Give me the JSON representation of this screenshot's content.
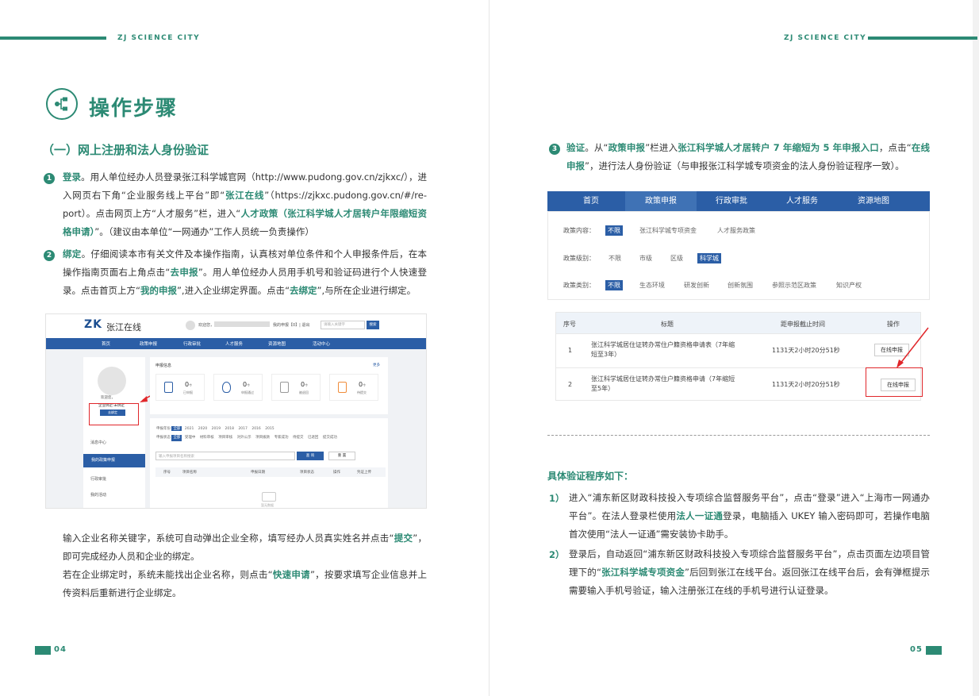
{
  "header": {
    "brand": "ZJ SCIENCE CITY"
  },
  "left": {
    "title": "操作步骤",
    "section_heading": "（一）网上注册和法人身份验证",
    "step1": {
      "num": "1",
      "label": "登录",
      "t1": "。用人单位经办人员登录张江科学城官网（http://www.pudong.gov.cn/zjkxc/），进入网页右下角“企业服务线上平台”即“",
      "h1": "张江在线",
      "t2": "”（https://zjkxc.pudong.gov.cn/#/re-port）。点击网页上方“人才服务”栏，进入“",
      "h2": "人才政策（张江科学城人才居转户年限缩短资格申请）",
      "t3": "”。（建议由本单位“一网通办”工作人员统一负责操作）"
    },
    "step2": {
      "num": "2",
      "label": "绑定",
      "t1": "。仔细阅读本市有关文件及本操作指南，认真核对单位条件和个人申报条件后，在本操作指南页面右上角点击“",
      "h1": "去申报",
      "t2": "”。用人单位经办人员用手机号和验证码进行个人快速登录。点击首页上方“",
      "h2": "我的申报",
      "t3": "”,进入企业绑定界面。点击“",
      "h3": "去绑定",
      "t4": "”,与所在企业进行绑定。"
    },
    "shot": {
      "logo": "ZK",
      "site": "张江在线",
      "welcome": "欢迎您，",
      "menu": "我的申报【0】| 退出",
      "search_ph": "请输入关键字",
      "search_btn": "搜索",
      "nav": [
        "首页",
        "政策申报",
        "行政审批",
        "人才服务",
        "资源地图",
        "活动中心"
      ],
      "user_hello": "欢迎您，",
      "user_status": "企业绑定:未绑定",
      "bind_btn": "去绑定",
      "side_menu": [
        "消息中心",
        "我的政策申报",
        "行政审批",
        "我的活动"
      ],
      "panel_title": "申报信息",
      "panel_more": "更多",
      "cards": [
        {
          "num": "0",
          "unit": "个",
          "label": "已申报"
        },
        {
          "num": "0",
          "unit": "个",
          "label": "申报通过"
        },
        {
          "num": "0",
          "unit": "个",
          "label": "被退回"
        },
        {
          "num": "0",
          "unit": "个",
          "label": "待提交"
        }
      ],
      "year_label": "申报年份",
      "years": [
        "全部",
        "2021",
        "2020",
        "2019",
        "2018",
        "2017",
        "2016",
        "2015"
      ],
      "status_label": "申报状态",
      "statuses": [
        "全部",
        "受理中",
        "材料审核",
        "项目审核",
        "对外公示",
        "项目拨款",
        "专家成功",
        "待提交",
        "已退回",
        "提交成功"
      ],
      "input_ph": "输入申报项目名称搜索",
      "query_btn": "查 询",
      "reset_btn": "重 置",
      "cols": [
        "序号",
        "项目名称",
        "申报日期",
        "项目状态",
        "操作",
        "凭证上传"
      ],
      "empty": "暂无数据"
    },
    "para3": {
      "t1": "输入企业名称关键字，系统可自动弹出企业全称，填写经办人员真实姓名并点击“",
      "h1": "提交",
      "t2": "”，即可完成经办人员和企业的绑定。"
    },
    "para4": {
      "t1": "若在企业绑定时，系统未能找出企业名称，则点击“",
      "h1": "快速申请",
      "t2": "”，按要求填写企业信息并上传资料后重新进行企业绑定。"
    },
    "page_num": "04"
  },
  "right": {
    "step3": {
      "num": "3",
      "label": "验证",
      "t1": "。从“",
      "h1": "政策申报",
      "t2": "”栏进入",
      "h2": "张江科学城人才居转户 7 年缩短为 5 年申报入口",
      "t3": "，点击“",
      "h3": "在线申报",
      "t4": "”，进行法人身份验证（与申报张江科学城专项资金的法人身份验证程序一致）。"
    },
    "shot": {
      "tabs": [
        "首页",
        "政策申报",
        "行政审批",
        "人才服务",
        "资源地图"
      ],
      "filters": [
        {
          "label": "政策内容：",
          "options": [
            "不限",
            "张江科学城专项资金",
            "人才服务政策"
          ],
          "selected": 0
        },
        {
          "label": "政策级别：",
          "options": [
            "不限",
            "市级",
            "区级",
            "科学城"
          ],
          "selected": 3
        },
        {
          "label": "政策类别：",
          "options": [
            "不限",
            "生态环境",
            "研发创新",
            "创新氛围",
            "参照示范区政策",
            "知识产权"
          ],
          "selected": 0
        }
      ],
      "cols": [
        "序号",
        "标题",
        "距申报截止时间",
        "操作"
      ],
      "rows": [
        {
          "no": "1",
          "title_a": "张江科学城居住证转办常住户籍资格申请表（7年缩",
          "title_b": "短至3年）",
          "time": "1131天2小时20分51秒",
          "action": "在线申报"
        },
        {
          "no": "2",
          "title_a": "张江科学城居住证转办常住户籍资格申请（7年缩短",
          "title_b": "至5年）",
          "time": "1131天2小时20分51秒",
          "action": "在线申报"
        }
      ]
    },
    "proc_heading": "具体验证程序如下：",
    "proc1": {
      "num": "1）",
      "t1": "进入“浦东新区财政科技投入专项综合监督服务平台”，点击“登录”进入“上海市一网通办平台”。在法人登录栏使用",
      "h1": "法人一证通",
      "t2": "登录，电脑插入 UKEY 输入密码即可，若操作电脑首次使用“法人一证通”需安装协卡助手。"
    },
    "proc2": {
      "num": "2）",
      "t1": "登录后，自动返回“浦东新区财政科技投入专项综合监督服务平台”，点击页面左边项目管理下的“",
      "h1": "张江科学城专项资金",
      "t2": "”后回到张江在线平台。返回张江在线平台后，会有弹框提示需要输入手机号验证，输入注册张江在线的手机号进行认证登录。"
    },
    "page_num": "05"
  },
  "colors": {
    "accent": "#2c8a74",
    "nav_blue": "#2b5ea6",
    "highlight_red": "#e0262a"
  }
}
